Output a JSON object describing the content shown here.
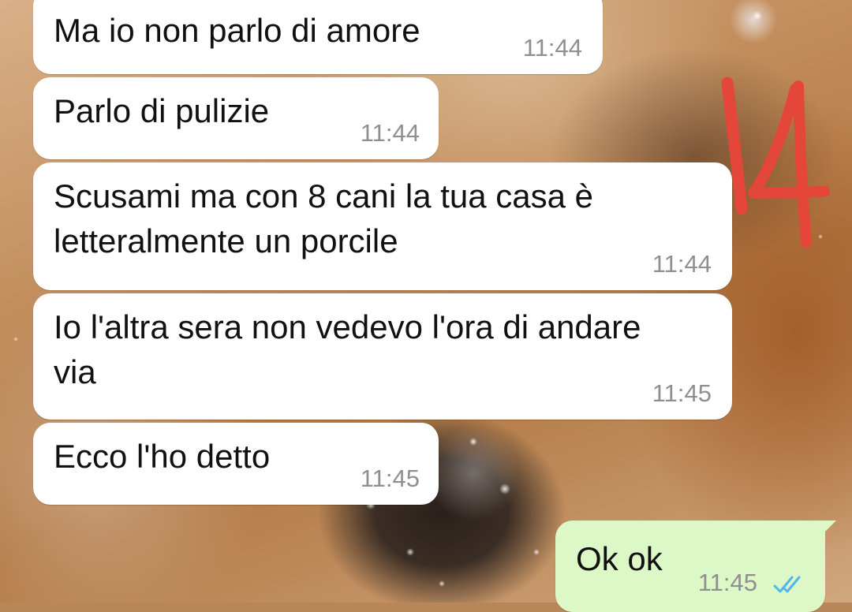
{
  "annotation": {
    "text": "14",
    "color": "#e5463a"
  },
  "colors": {
    "incoming_bubble": "#ffffff",
    "outgoing_bubble": "#dcf8c6",
    "timestamp": "#8f8f8f",
    "read_ticks": "#4fb6ec"
  },
  "messages": [
    {
      "text": "Ma io non parlo di amore",
      "time": "11:44",
      "direction": "in"
    },
    {
      "text": "Parlo di pulizie",
      "time": "11:44",
      "direction": "in"
    },
    {
      "line1": "Scusami ma con 8 cani la tua casa è",
      "line2": "letteralmente un porcile",
      "time": "11:44",
      "direction": "in"
    },
    {
      "line1": "Io l'altra sera non vedevo l'ora di andare",
      "line2": "via",
      "time": "11:45",
      "direction": "in"
    },
    {
      "text": "Ecco l'ho detto",
      "time": "11:45",
      "direction": "in"
    },
    {
      "text": "Ok ok",
      "time": "11:45",
      "direction": "out",
      "status": "read",
      "status_icon": "double-check-icon"
    }
  ]
}
